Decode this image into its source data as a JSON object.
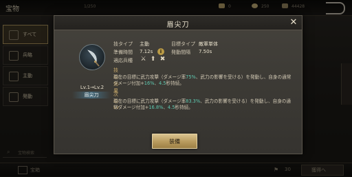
{
  "background": {
    "title": "宝物",
    "slot_count": "1/250",
    "resources": [
      "0",
      "250",
      "44428"
    ],
    "sidebar": [
      {
        "label": "すべて",
        "icon": "all-icon"
      },
      {
        "label": "兵略",
        "icon": "tactics-icon"
      },
      {
        "label": "主動",
        "icon": "active-icon"
      },
      {
        "label": "発動",
        "icon": "trigger-icon"
      }
    ],
    "search_label": "宝物検索",
    "bottom_left_label": "宝箱",
    "bottom_count": "30",
    "bottom_button": "獲得へ"
  },
  "modal": {
    "title": "眉尖刀",
    "close_icon": "close-icon",
    "weapon_icon": "glaive-icon",
    "level_range": "Lv.1→Lv.2",
    "weapon_name": "眉尖刀",
    "skill_type_label": "技タイプ",
    "skill_type_value": "主動",
    "target_type_label": "目標タイプ",
    "target_type_value": "敵軍単体",
    "prep_time_label": "準備時間",
    "prep_time_value": "7.12s",
    "interval_label": "発動間隔",
    "interval_value": "7.50s",
    "arms_label": "適応兵種",
    "arms_icons": [
      "crossed-swords-icon",
      "spear-icon",
      "bow-icon"
    ],
    "effect_title": "技の効果",
    "effect_text": {
      "p1": "現在の目標に武力攻撃（ダメージ率",
      "rate": "75%",
      "p2": "、武力の影響を受ける）を発動し、自身の通常ダメージ付加+",
      "bonus": "16%",
      "p3": "、",
      "dur": "4.5",
      "p4": "秒持続。"
    },
    "next_title": "次のLv",
    "next_text": {
      "p1": "現在の目標に武力攻撃（ダメージ率",
      "rate": "83.3%",
      "p2": "、武力の影響を受ける）を発動し、自身の通常ダメージ付加+",
      "bonus": "16.8%",
      "p3": "、",
      "dur": "4.5",
      "p4": "秒持続。"
    },
    "equip_label": "装備"
  },
  "colors": {
    "accent_teal": "#5fc9b0",
    "section_gold": "#c8a96a",
    "button_gold": "#b79a5d"
  }
}
